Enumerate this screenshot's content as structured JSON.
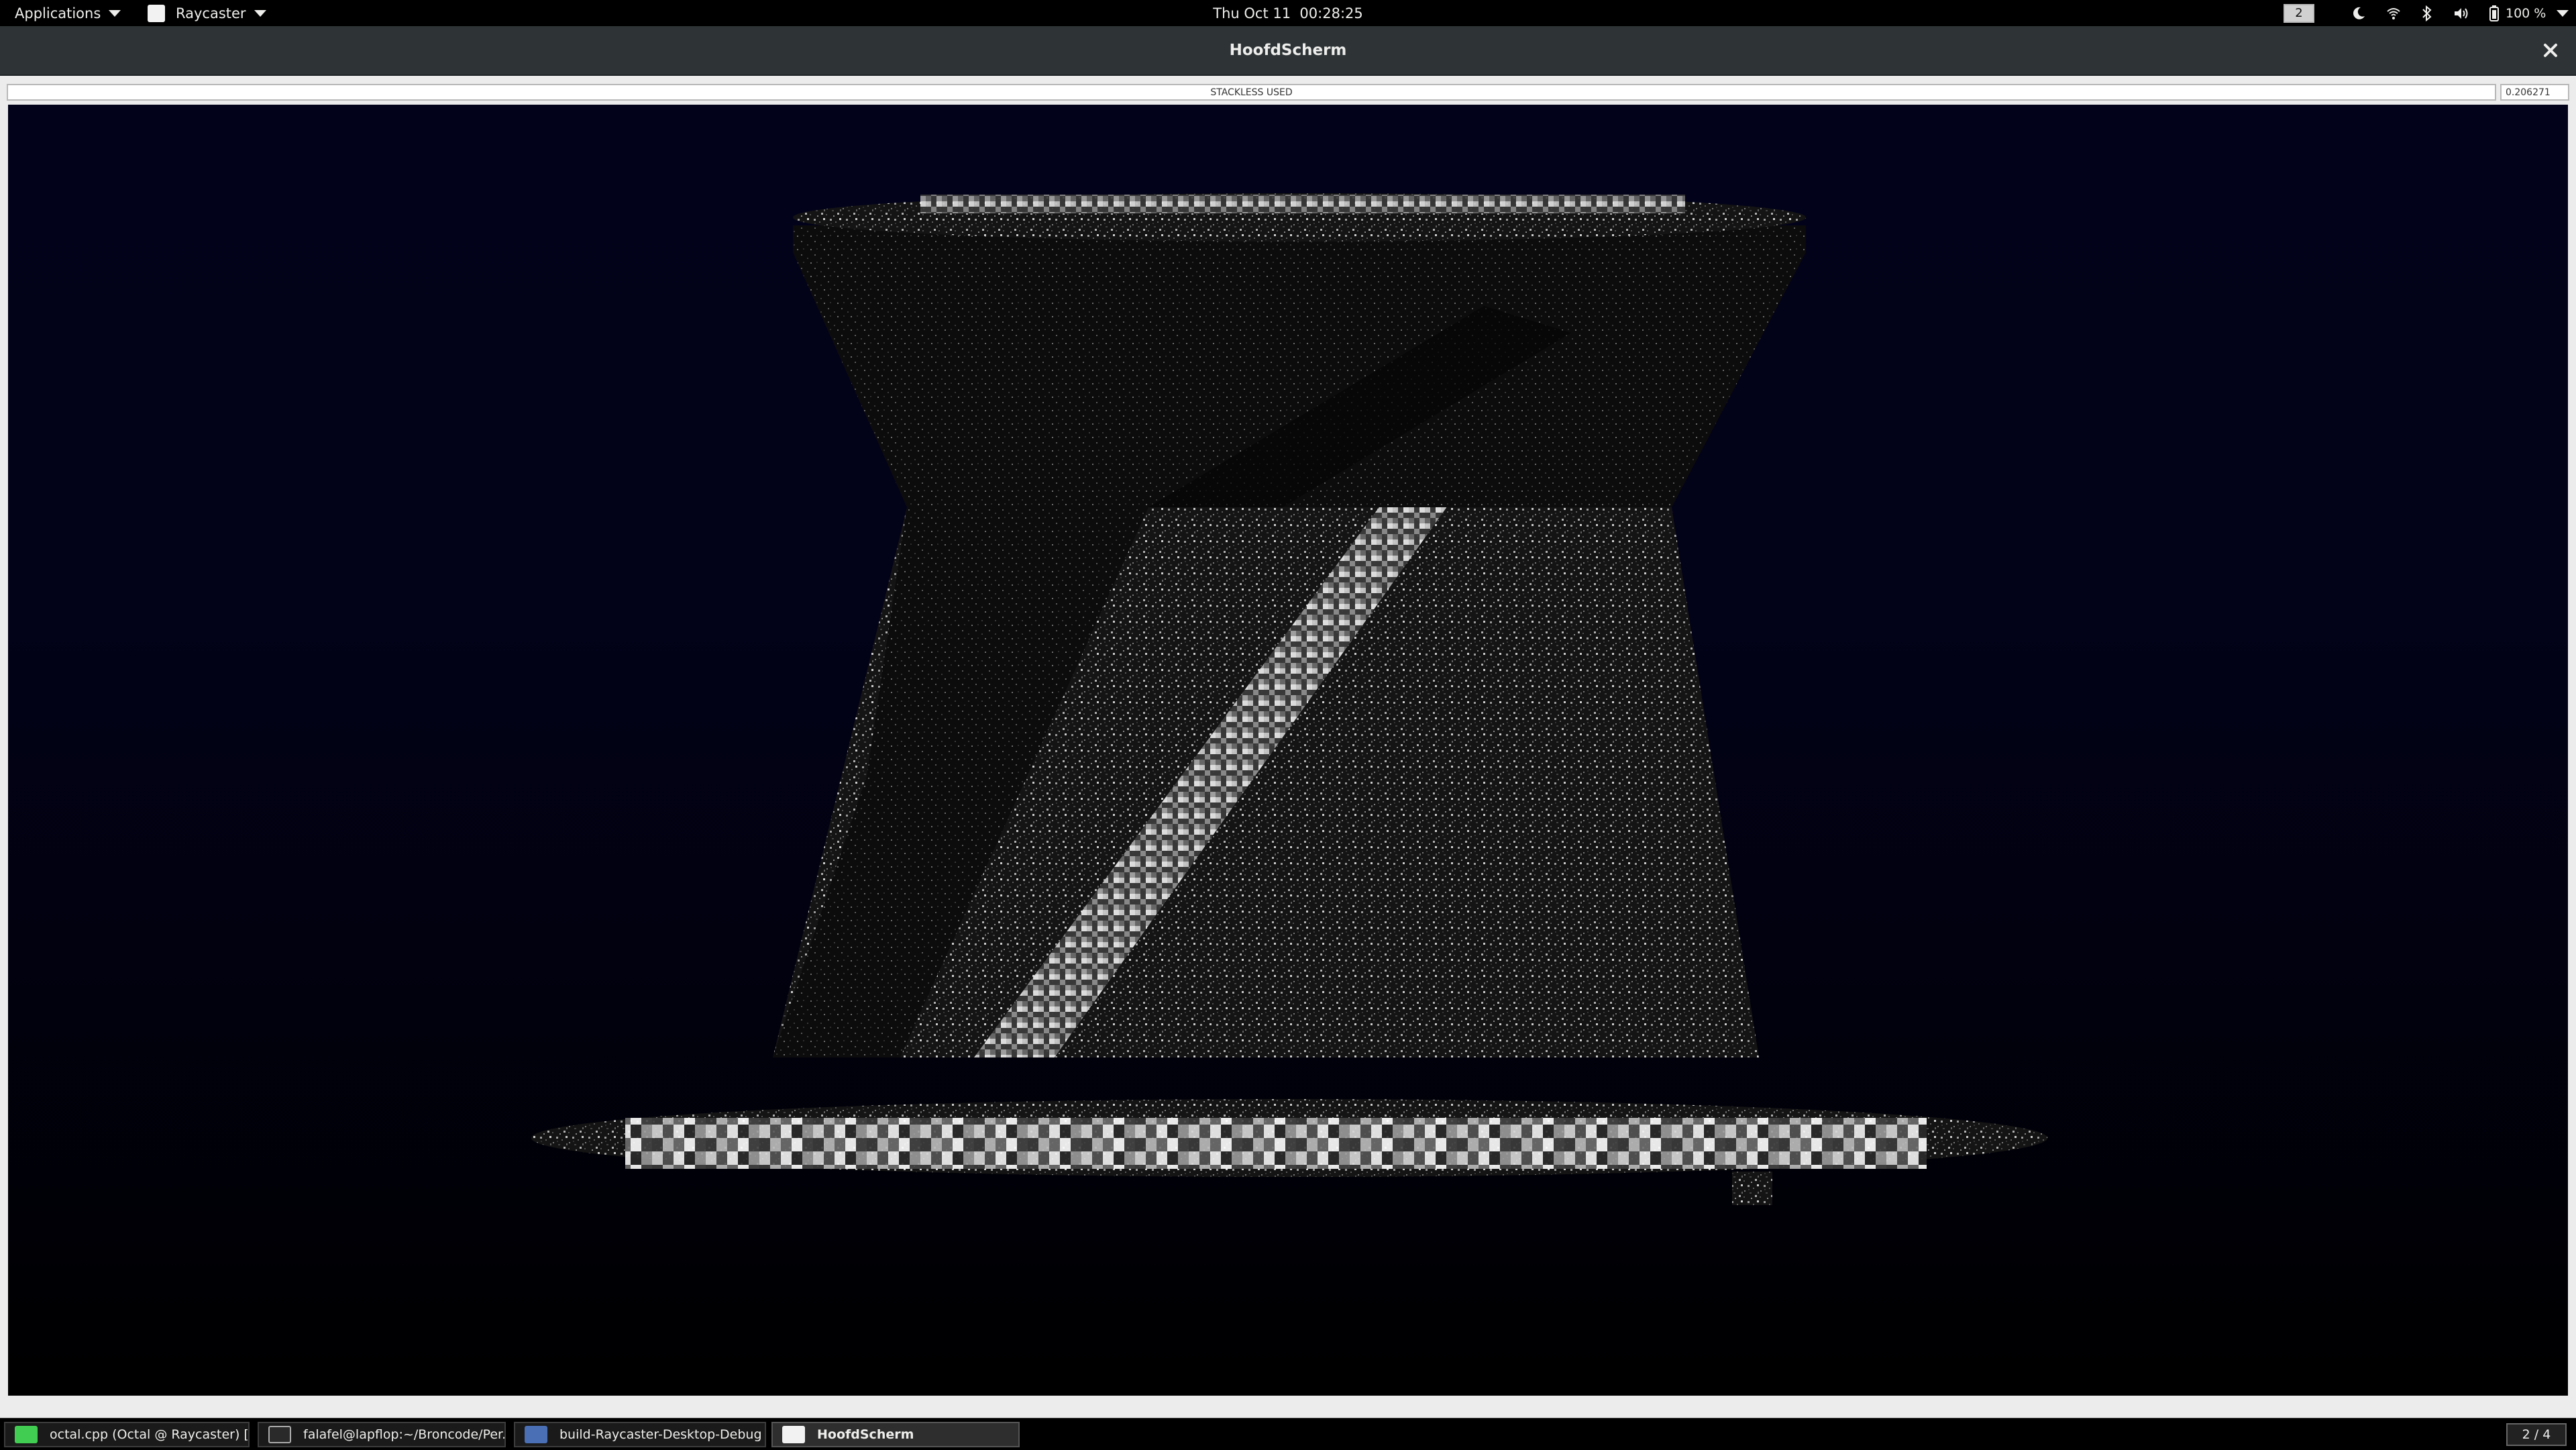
{
  "top_panel": {
    "applications_label": "Applications",
    "app_menu_label": "Raycaster",
    "clock": "Thu Oct 11  00:28:25",
    "workspace_number": "2",
    "battery_label": "100 %",
    "icons": [
      "night-light-icon",
      "wifi-icon",
      "bluetooth-icon",
      "volume-icon",
      "battery-icon"
    ]
  },
  "window": {
    "title": "HoofdScherm",
    "status_text": "STACKLESS USED",
    "value_text": "0.206271"
  },
  "viewport": {
    "background_top": "#02021a",
    "background_bottom": "#000000",
    "content": "raycast-voxel-render"
  },
  "taskbar": {
    "tasks": [
      {
        "label": "octal.cpp (Octal @ Raycaster) [m...",
        "icon": "qt-creator-icon",
        "active": false
      },
      {
        "label": "falafel@lapflop:~/Broncode/Per...",
        "icon": "terminal-icon",
        "active": false
      },
      {
        "label": "build-Raycaster-Desktop-Debug",
        "icon": "folder-icon",
        "active": false
      },
      {
        "label": "HoofdScherm",
        "icon": "window-icon",
        "active": true
      }
    ],
    "workspace_indicator": "2 / 4"
  }
}
